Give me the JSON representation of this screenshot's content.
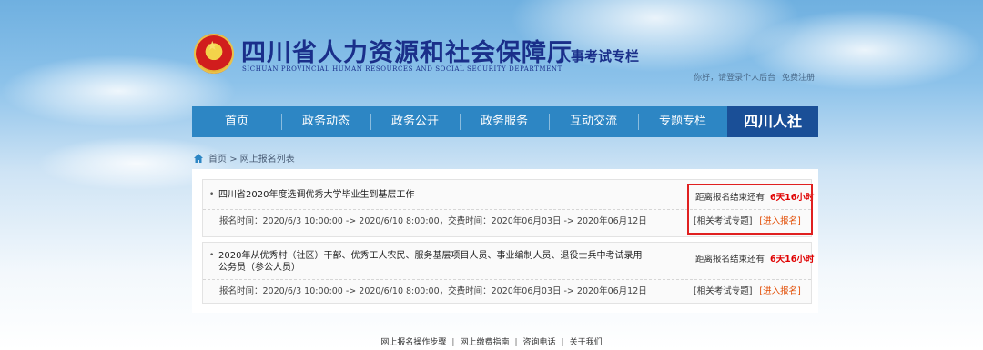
{
  "header": {
    "site_title": "四川省人力资源和社会保障厅",
    "site_subtitle": "SICHUAN PROVINCIAL HUMAN RESOURCES AND SOCIAL SECURITY DEPARTMENT",
    "section_title": "人事考试专栏",
    "greeting": "你好，请登录个人后台",
    "register_link": "免费注册"
  },
  "nav": {
    "items": [
      "首页",
      "政务动态",
      "政务公开",
      "政务服务",
      "互动交流",
      "专题专栏"
    ],
    "brand": "四川人社"
  },
  "breadcrumb": {
    "home": "首页",
    "separator": ">",
    "current": "网上报名列表"
  },
  "listings": [
    {
      "title": "四川省2020年度选调优秀大学毕业生到基层工作",
      "meta": "报名时间：2020/6/3 10:00:00 -> 2020/6/10 8:00:00，交费时间：2020年06月03日 -> 2020年06月12日",
      "countdown_label": "距离报名结束还有",
      "countdown_value": "6天16小时",
      "topic_link": "[相关考试专题]",
      "apply_link": "[进入报名]"
    },
    {
      "title": "2020年从优秀村（社区）干部、优秀工人农民、服务基层项目人员、事业编制人员、退役士兵中考试录用公务员（参公人员）",
      "meta": "报名时间：2020/6/3 10:00:00 -> 2020/6/10 8:00:00，交费时间：2020年06月03日 -> 2020年06月12日",
      "countdown_label": "距离报名结束还有",
      "countdown_value": "6天16小时",
      "topic_link": "[相关考试专题]",
      "apply_link": "[进入报名]"
    }
  ],
  "footer": {
    "links": [
      "网上报名操作步骤",
      "网上缴费指南",
      "咨询电话",
      "关于我们"
    ],
    "separator": "|"
  },
  "colors": {
    "nav_bg": "#2d86c4",
    "brand_bg": "#1a4f97",
    "title_blue": "#1a2f8a",
    "countdown_red": "#e00000",
    "apply_orange": "#e24b00",
    "highlight_red": "#e02020"
  }
}
